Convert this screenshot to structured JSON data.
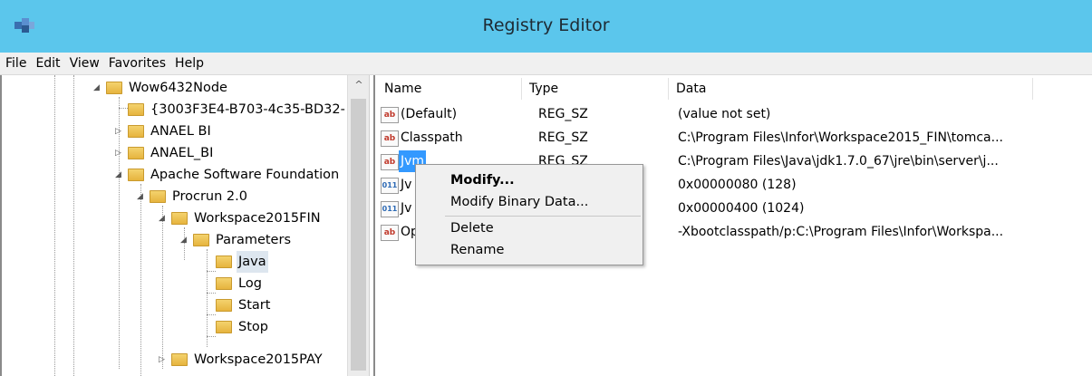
{
  "window": {
    "title": "Registry Editor"
  },
  "menu": [
    "File",
    "Edit",
    "View",
    "Favorites",
    "Help"
  ],
  "tree": [
    {
      "label": "Wow6432Node",
      "expander": "◢"
    },
    {
      "label": "{3003F3E4-B703-4c35-BD32-",
      "expander": ""
    },
    {
      "label": "ANAEL BI",
      "expander": "▷"
    },
    {
      "label": "ANAEL_BI",
      "expander": "▷"
    },
    {
      "label": "Apache Software Foundation",
      "expander": "◢"
    },
    {
      "label": "Procrun 2.0",
      "expander": "◢"
    },
    {
      "label": "Workspace2015FIN",
      "expander": "◢"
    },
    {
      "label": "Parameters",
      "expander": "◢"
    },
    {
      "label": "Java",
      "expander": "",
      "selected": true
    },
    {
      "label": "Log",
      "expander": ""
    },
    {
      "label": "Start",
      "expander": ""
    },
    {
      "label": "Stop",
      "expander": ""
    },
    {
      "label": "Workspace2015PAY",
      "expander": "▷"
    }
  ],
  "columns": {
    "name": "Name",
    "type": "Type",
    "data": "Data"
  },
  "values": [
    {
      "name": "(Default)",
      "type": "REG_SZ",
      "data": "(value not set)",
      "icon": "ab"
    },
    {
      "name": "Classpath",
      "type": "REG_SZ",
      "data": "C:\\Program Files\\Infor\\Workspace2015_FIN\\tomca...",
      "icon": "ab"
    },
    {
      "name": "Jvm",
      "type": "REG_SZ",
      "data": "C:\\Program Files\\Java\\jdk1.7.0_67\\jre\\bin\\server\\j...",
      "icon": "ab",
      "selected": true
    },
    {
      "name": "Jv",
      "type": "",
      "data": "0x00000080 (128)",
      "icon": "011"
    },
    {
      "name": "Jv",
      "type": "",
      "data": "0x00000400 (1024)",
      "icon": "011"
    },
    {
      "name": "Op",
      "type": "",
      "data": "-Xbootclasspath/p:C:\\Program Files\\Infor\\Workspa...",
      "icon": "ab"
    }
  ],
  "context_menu": {
    "modify": "Modify...",
    "modify_binary": "Modify Binary Data...",
    "delete": "Delete",
    "rename": "Rename"
  },
  "colors": {
    "titlebar": "#5bc6ec",
    "selection": "#3399ff"
  }
}
